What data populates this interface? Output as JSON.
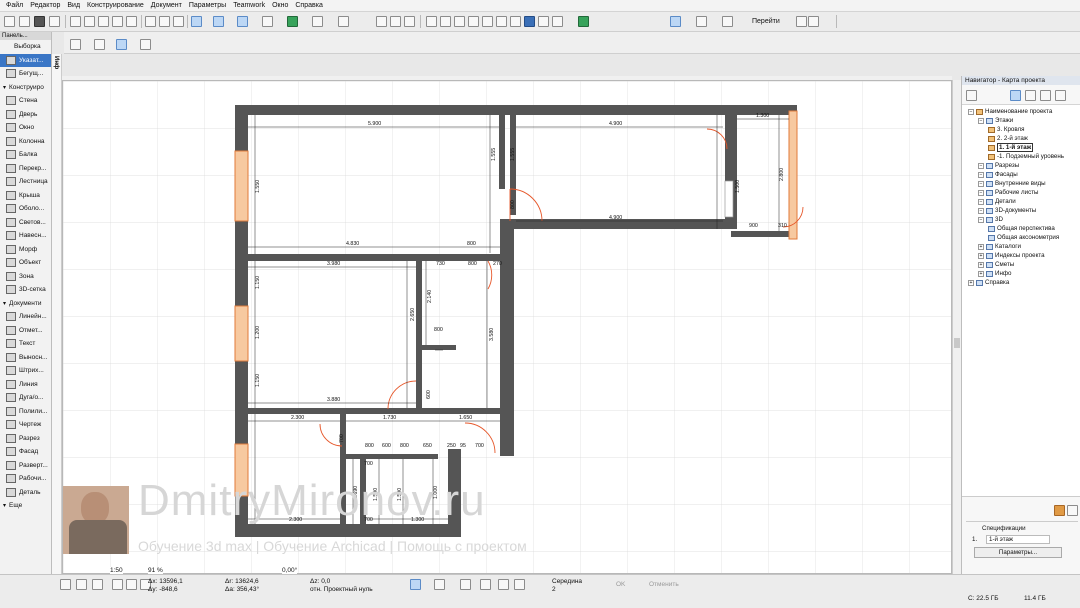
{
  "menu": [
    "Файл",
    "Редактор",
    "Вид",
    "Конструирование",
    "Документ",
    "Параметры",
    "Teamwork",
    "Окно",
    "Справка"
  ],
  "toolbar": {
    "goto_label": "Перейти"
  },
  "left_panel": {
    "title": "Панель...",
    "selection_label": "Выборка",
    "items": [
      {
        "label": "Указат...",
        "type": "tool",
        "selected": true
      },
      {
        "label": "Бегущ...",
        "type": "tool"
      },
      {
        "label": "Конструиро",
        "type": "category"
      },
      {
        "label": "Стена",
        "type": "tool"
      },
      {
        "label": "Дверь",
        "type": "tool"
      },
      {
        "label": "Окно",
        "type": "tool"
      },
      {
        "label": "Колонна",
        "type": "tool"
      },
      {
        "label": "Балка",
        "type": "tool"
      },
      {
        "label": "Перекр...",
        "type": "tool"
      },
      {
        "label": "Лестница",
        "type": "tool"
      },
      {
        "label": "Крыша",
        "type": "tool"
      },
      {
        "label": "Оболо...",
        "type": "tool"
      },
      {
        "label": "Светов...",
        "type": "tool"
      },
      {
        "label": "Навесн...",
        "type": "tool"
      },
      {
        "label": "Морф",
        "type": "tool"
      },
      {
        "label": "Объект",
        "type": "tool"
      },
      {
        "label": "Зона",
        "type": "tool"
      },
      {
        "label": "3D-сетка",
        "type": "tool"
      },
      {
        "label": "Документи",
        "type": "category"
      },
      {
        "label": "Линейн...",
        "type": "tool"
      },
      {
        "label": "Отмет...",
        "type": "tool"
      },
      {
        "label": "Текст",
        "type": "tool"
      },
      {
        "label": "Выносн...",
        "type": "tool"
      },
      {
        "label": "Штрих...",
        "type": "tool"
      },
      {
        "label": "Линия",
        "type": "tool"
      },
      {
        "label": "Дуга/о...",
        "type": "tool"
      },
      {
        "label": "Полили...",
        "type": "tool"
      },
      {
        "label": "Чертеж",
        "type": "tool"
      },
      {
        "label": "Разрез",
        "type": "tool"
      },
      {
        "label": "Фасад",
        "type": "tool"
      },
      {
        "label": "Разверт...",
        "type": "tool"
      },
      {
        "label": "Рабочи...",
        "type": "tool"
      },
      {
        "label": "Деталь",
        "type": "tool"
      },
      {
        "label": "Еще",
        "type": "category"
      }
    ]
  },
  "info_rail_label": "Инф",
  "navigator": {
    "title": "Навигатор - Карта проекта",
    "tree": [
      {
        "label": "Наименование проекта",
        "level": 0,
        "kind": "folder"
      },
      {
        "label": "Этажи",
        "level": 1,
        "kind": "folder-b"
      },
      {
        "label": "3. Кровля",
        "level": 2,
        "kind": "story"
      },
      {
        "label": "2. 2-й этаж",
        "level": 2,
        "kind": "story"
      },
      {
        "label": "1. 1-й этаж",
        "level": 2,
        "kind": "story",
        "selected": true
      },
      {
        "label": "-1. Подземный уровень",
        "level": 2,
        "kind": "story"
      },
      {
        "label": "Разрезы",
        "level": 1,
        "kind": "folder-b"
      },
      {
        "label": "Фасады",
        "level": 1,
        "kind": "folder-b"
      },
      {
        "label": "Внутренние виды",
        "level": 1,
        "kind": "folder-b"
      },
      {
        "label": "Рабочие листы",
        "level": 1,
        "kind": "folder-b"
      },
      {
        "label": "Детали",
        "level": 1,
        "kind": "folder-b"
      },
      {
        "label": "3D-документы",
        "level": 1,
        "kind": "folder-b"
      },
      {
        "label": "3D",
        "level": 1,
        "kind": "folder-b"
      },
      {
        "label": "Общая перспектива",
        "level": 2,
        "kind": "view"
      },
      {
        "label": "Общая аксонометрия",
        "level": 2,
        "kind": "view"
      },
      {
        "label": "Каталоги",
        "level": 1,
        "kind": "folder-b",
        "plus": true
      },
      {
        "label": "Индексы проекта",
        "level": 1,
        "kind": "folder-b",
        "plus": true
      },
      {
        "label": "Сметы",
        "level": 1,
        "kind": "folder-b",
        "plus": true
      },
      {
        "label": "Инфо",
        "level": 1,
        "kind": "folder-b",
        "plus": true
      },
      {
        "label": "Справка",
        "level": 0,
        "kind": "folder-b",
        "plus": true
      }
    ],
    "spec_label": "Спецификации",
    "story_num": "1.",
    "story_name": "1-й этаж",
    "params_button": "Параметры..."
  },
  "plan": {
    "dimensions": [
      "5.900",
      "4.900",
      "1.300",
      "4.830",
      "800",
      "3.980",
      "730",
      "800",
      "270",
      "2.650",
      "2.140",
      "3.580",
      "800",
      "600",
      "3.880",
      "2.300",
      "1.730",
      "1.650",
      "700",
      "800",
      "600",
      "800",
      "650",
      "250",
      "95",
      "700",
      "1.300",
      "2.300",
      "700",
      "700",
      "1.500",
      "1.500",
      "2.800",
      "1.550",
      "1.500",
      "900",
      "310",
      "1.555",
      "1.555",
      "800",
      "4.900",
      "1.150",
      "1.150",
      "1.200",
      "1.690",
      "1.000"
    ]
  },
  "statusbar": {
    "scale": "1:50",
    "zoom": "91 %",
    "angle": "0,00°",
    "dx": "Δx: 13596,1",
    "dy": "Δy: -848,6",
    "dr": "Δr: 13624,6",
    "da": "Δa: 356,43°",
    "dz": "Δz: 0,0",
    "zref": "отн. Проектный нуль",
    "snap_label": "Середина",
    "snap_val": "2",
    "ok": "OK",
    "cancel": "Отменить",
    "disk_c": "C: 22.5 ГБ",
    "mem": "11.4 ГБ"
  },
  "watermark": {
    "title": "DmitryMironov.ru",
    "subtitle": "Обучение 3d max | Обучение Archicad | Помощь с проектом"
  },
  "colors": {
    "wall": "#555555",
    "window": "#f4a460",
    "door": "#e6572a",
    "accent": "#3a76c6"
  }
}
